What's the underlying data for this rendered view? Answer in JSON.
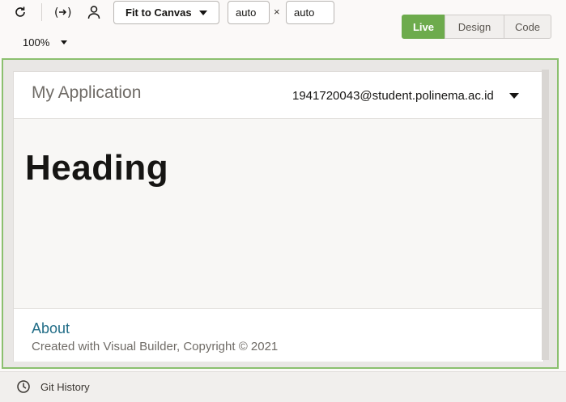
{
  "toolbar": {
    "refresh_icon": "refresh-icon",
    "variables_icon": "variables-icon",
    "user_icon": "user-icon",
    "fit_select_value": "Fit to Canvas",
    "width_value": "auto",
    "times": "×",
    "height_value": "auto",
    "zoom_value": "100%",
    "modes": {
      "live": "Live",
      "design": "Design",
      "code": "Code"
    },
    "accent_color": "#6dab4d"
  },
  "app": {
    "title": "My Application",
    "user_email": "1941720043@student.polinema.ac.id",
    "heading": "Heading",
    "footer": {
      "about": "About",
      "copyright": "Created with Visual Builder, Copyright © 2021"
    }
  },
  "bottom": {
    "git_history": "Git History"
  }
}
